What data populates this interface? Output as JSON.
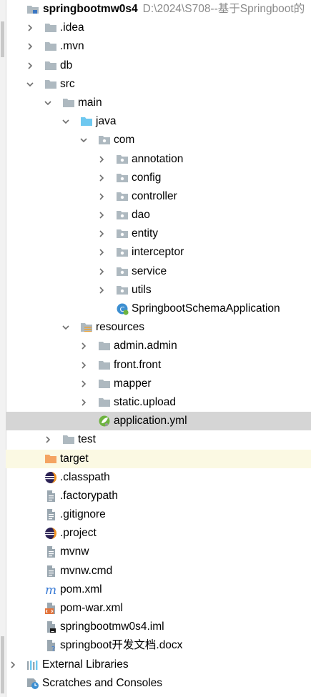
{
  "project": {
    "name": "springbootmw0s4",
    "path": "D:\\2024\\S708--基于Springboot的"
  },
  "tree": {
    "idea": ".idea",
    "mvn": ".mvn",
    "db": "db",
    "src": "src",
    "main": "main",
    "java": "java",
    "com": "com",
    "annotation": "annotation",
    "config": "config",
    "controller": "controller",
    "dao": "dao",
    "entity": "entity",
    "interceptor": "interceptor",
    "service": "service",
    "utils": "utils",
    "app_class": "SpringbootSchemaApplication",
    "resources": "resources",
    "admin": "admin.admin",
    "front": "front.front",
    "mapper": "mapper",
    "static_upload": "static.upload",
    "application_yml": "application.yml",
    "test": "test",
    "target": "target",
    "classpath": ".classpath",
    "factorypath": ".factorypath",
    "gitignore": ".gitignore",
    "project_file": ".project",
    "mvnw": "mvnw",
    "mvnw_cmd": "mvnw.cmd",
    "pom": "pom.xml",
    "pom_war": "pom-war.xml",
    "iml": "springbootmw0s4.iml",
    "docx": "springboot开发文档.docx",
    "external_libraries": "External Libraries",
    "scratches": "Scratches and Consoles"
  },
  "colors": {
    "selected_row": "#d5d5d5",
    "excluded_row": "#fbf9e3",
    "folder": "#aeb9c0",
    "source_folder": "#6ec8f0",
    "excluded_folder": "#f4a462",
    "spring_green": "#6db33f"
  }
}
